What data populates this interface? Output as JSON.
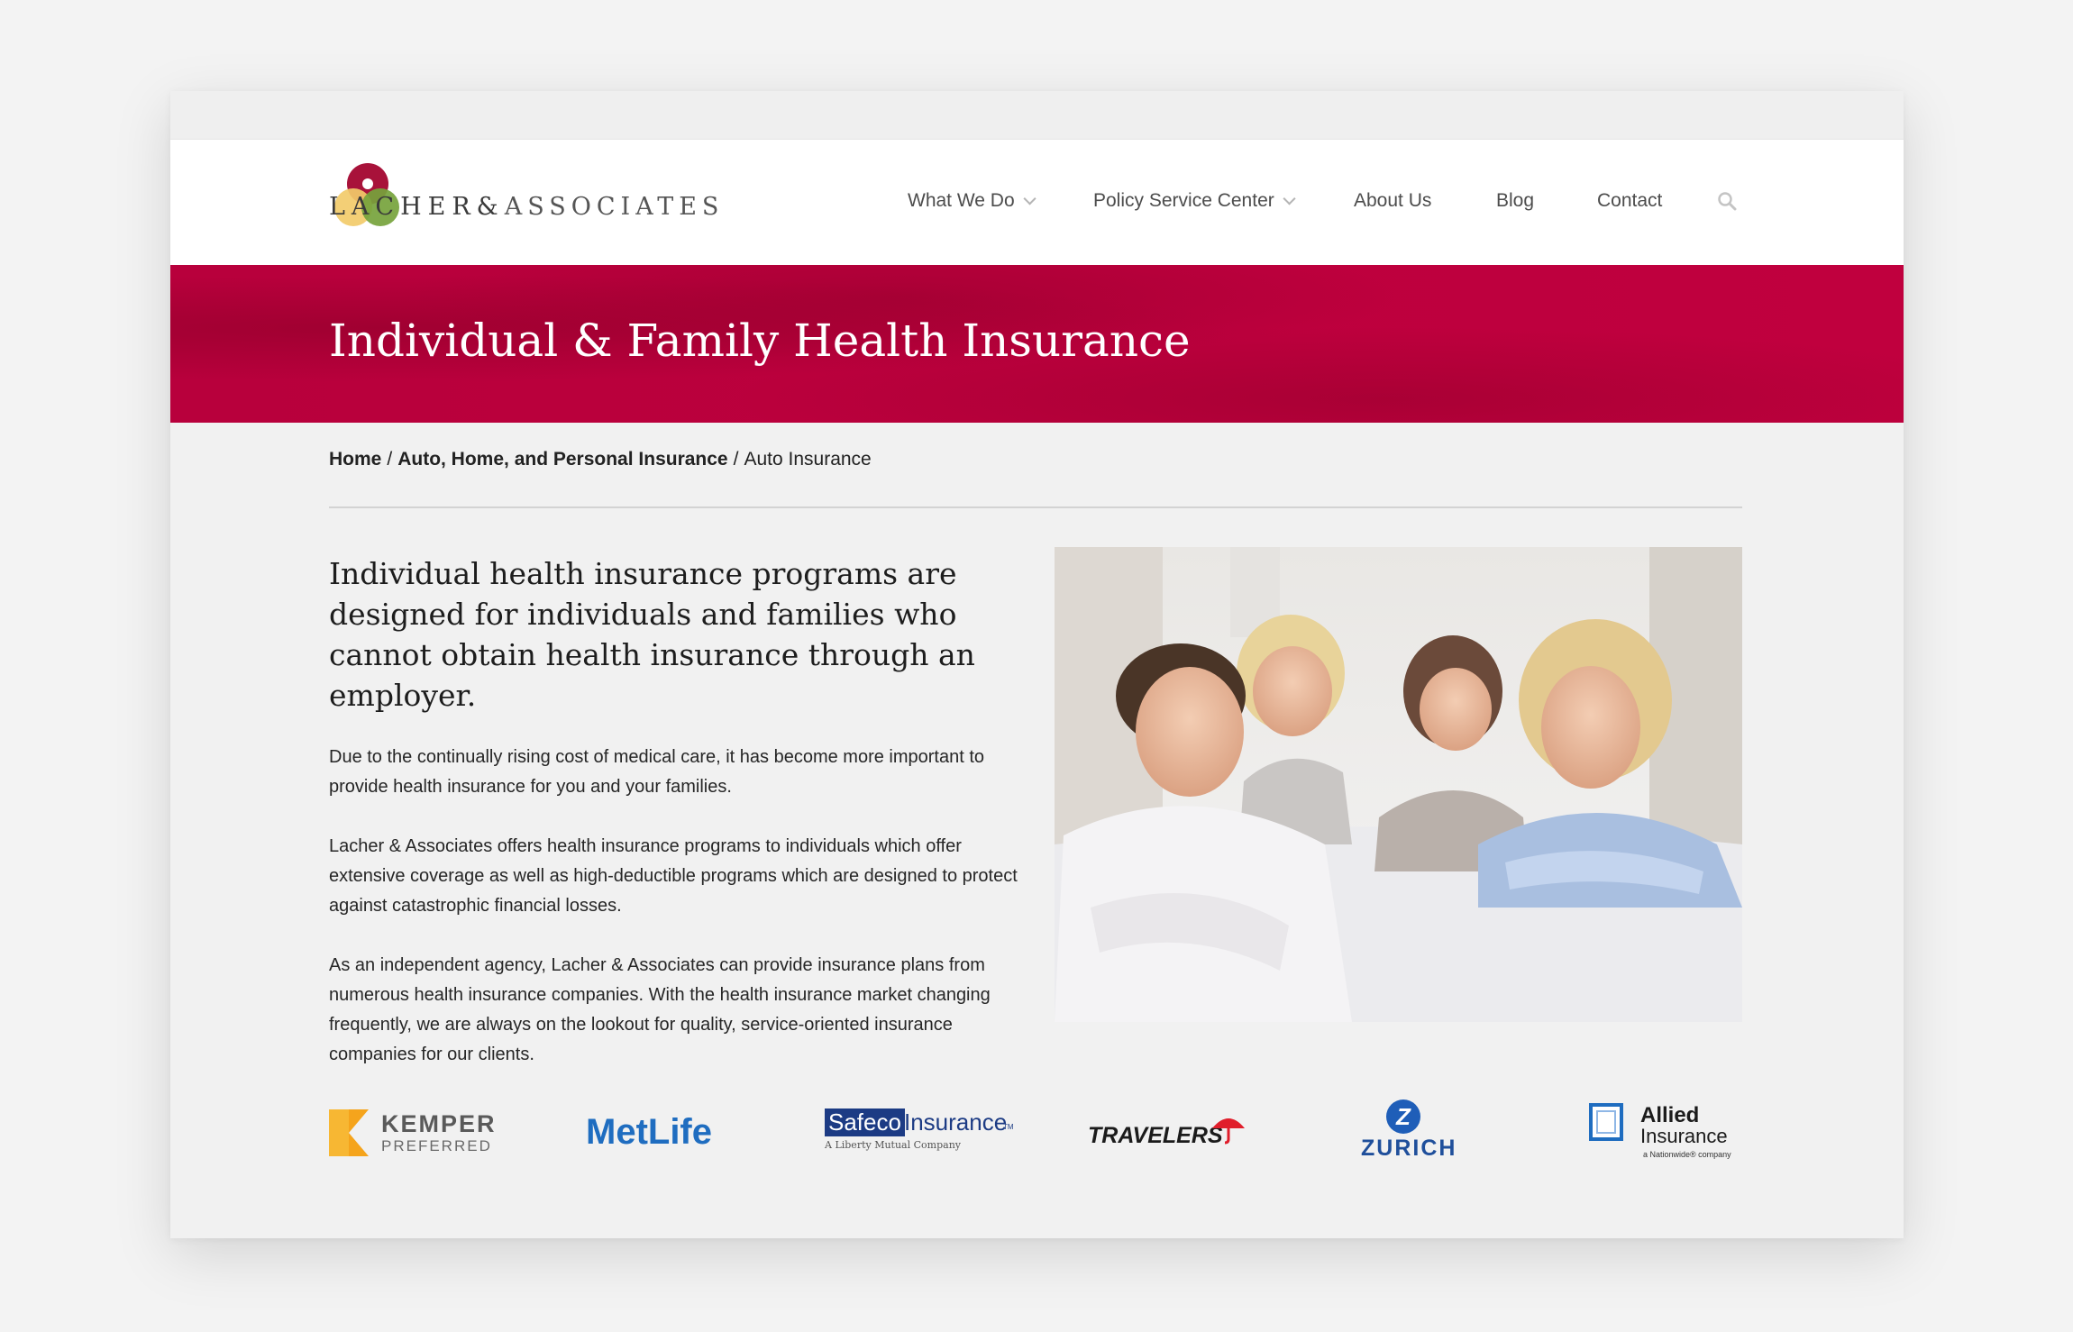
{
  "brand": {
    "name_part1": "LACHER",
    "ampersand": "&",
    "name_part2": "ASSOCIATES",
    "colors": {
      "crimson": "#b5003a",
      "gold": "#f2cb6a",
      "green": "#76a33c"
    }
  },
  "nav": {
    "items": [
      {
        "label": "What We Do",
        "has_dropdown": true
      },
      {
        "label": "Policy Service Center",
        "has_dropdown": true
      },
      {
        "label": "About Us",
        "has_dropdown": false
      },
      {
        "label": "Blog",
        "has_dropdown": false
      },
      {
        "label": "Contact",
        "has_dropdown": false
      }
    ],
    "search_icon": "search-icon"
  },
  "hero": {
    "title": "Individual & Family Health Insurance"
  },
  "breadcrumb": {
    "home": "Home",
    "separator": "/",
    "section": "Auto, Home, and Personal Insurance",
    "current": "Auto Insurance"
  },
  "main": {
    "lead": "Individual health insurance programs are designed for individuals and families who cannot obtain health insurance through an employer.",
    "paragraphs": [
      "Due to the continually rising cost of medical care, it has become more important to provide health insurance for you and your families.",
      "Lacher & Associates offers health insurance programs to individuals which offer extensive coverage as well as high-deductible programs which are designed to protect against catastrophic financial losses.",
      "As an independent agency, Lacher & Associates can provide insurance plans from numerous health insurance companies. With the health insurance market changing frequently, we are always on the lookout for quality, service-oriented insurance companies for our clients."
    ]
  },
  "partners": {
    "kemper": {
      "line1": "KEMPER",
      "line2": "PREFERRED"
    },
    "metlife": {
      "name": "MetLife"
    },
    "safeco": {
      "box": "Safeco",
      "word": "Insurance",
      "tm": "TM",
      "tagline": "A Liberty Mutual Company"
    },
    "travelers": {
      "name": "TRAVELERS"
    },
    "zurich": {
      "letter": "Z",
      "name": "ZURICH"
    },
    "allied": {
      "line1": "Allied",
      "line2": "Insurance",
      "tagline": "a Nationwide® company"
    }
  }
}
